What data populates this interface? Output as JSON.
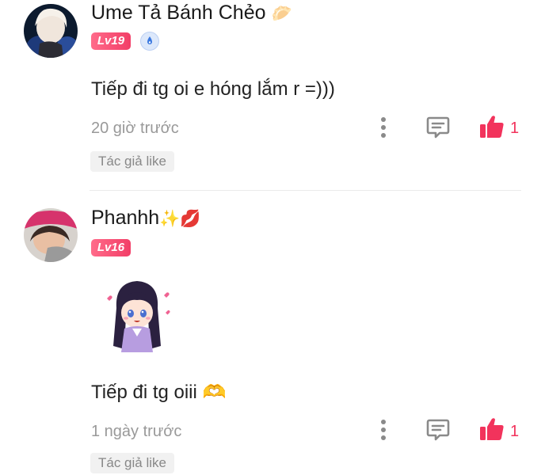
{
  "comments": [
    {
      "username": "Ume Tả Bánh Chẻo",
      "name_emoji": "🥟",
      "level": "Lv19",
      "text": "Tiếp đi tg oi e hóng lắm r =)))",
      "time": "20 giờ trước",
      "likes": "1",
      "tag": "Tác giả like"
    },
    {
      "username": "Phanhh",
      "name_emoji": "✨💋",
      "level": "Lv16",
      "text": "Tiếp đi tg oiii 🫶",
      "time": "1 ngày trước",
      "likes": "1",
      "tag": "Tác giả like"
    }
  ],
  "colors": {
    "accent": "#f2335c",
    "muted": "#999999",
    "tag_bg": "#f1f1f1"
  },
  "icons": [
    "more-vertical-icon",
    "reply-icon",
    "thumbs-up-icon",
    "verified-badge-icon"
  ]
}
